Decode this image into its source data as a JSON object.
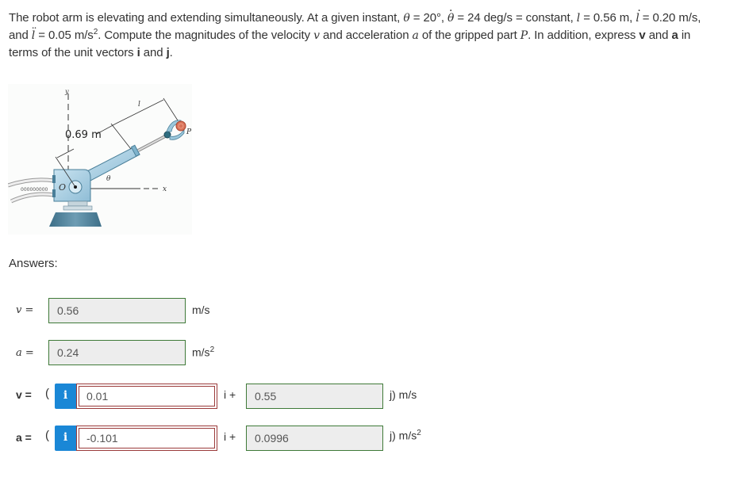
{
  "problem": {
    "line1_a": "The robot arm is elevating and extending simultaneously. At a given instant, ",
    "theta_sym": "θ",
    "theta_val": " = 20°, ",
    "thetadot_val": " = 24 deg/s = constant, ",
    "l_sym": "l",
    "l_val": " = 0.56 m, ",
    "ldot_val": " = 0.20 m/s,",
    "line2_a": "and ",
    "lddot_val": " = 0.05 m/s",
    "sq": "2",
    "line2_b": ". Compute the magnitudes of the velocity ",
    "v_sym": "v",
    "line2_c": " and acceleration ",
    "a_sym": "a",
    "line2_d": " of the gripped part ",
    "p_sym": "P",
    "line2_e": ". In addition, express ",
    "v_bold": "v",
    "and": " and ",
    "a_bold": "a",
    "line2_f": " in",
    "line3_a": "terms of the unit vectors ",
    "i_bold": "i",
    "line3_b": " and ",
    "j_bold": "j",
    "line3_c": "."
  },
  "figure": {
    "dimension_label": "0.69 m",
    "y_axis": "y",
    "x_axis": "x",
    "origin": "O",
    "angle": "θ",
    "length": "l",
    "point": "P"
  },
  "answers": {
    "heading": "Answers:",
    "v_mag": {
      "label": "v =",
      "value": "0.56",
      "unit": "m/s",
      "status": "correct"
    },
    "a_mag": {
      "label": "a =",
      "value": "0.24",
      "unit": "m/s",
      "unit_sup": "2",
      "status": "correct"
    },
    "v_vec": {
      "label": "v =",
      "open_paren": "(",
      "i_value": "0.01",
      "i_status": "incorrect",
      "i_sep": "i +",
      "j_value": "0.55",
      "j_status": "correct",
      "unit": "j) m/s"
    },
    "a_vec": {
      "label": "a =",
      "open_paren": "(",
      "i_value": "-0.101",
      "i_status": "incorrect",
      "i_sep": "i +",
      "j_value": "0.0996",
      "j_status": "correct",
      "unit": "j) m/s",
      "unit_sup": "2"
    },
    "info_icon": "i"
  },
  "colors": {
    "correct_border": "#3f7a38",
    "incorrect_border": "#9b3b3b",
    "info_button": "#1a87d6"
  }
}
